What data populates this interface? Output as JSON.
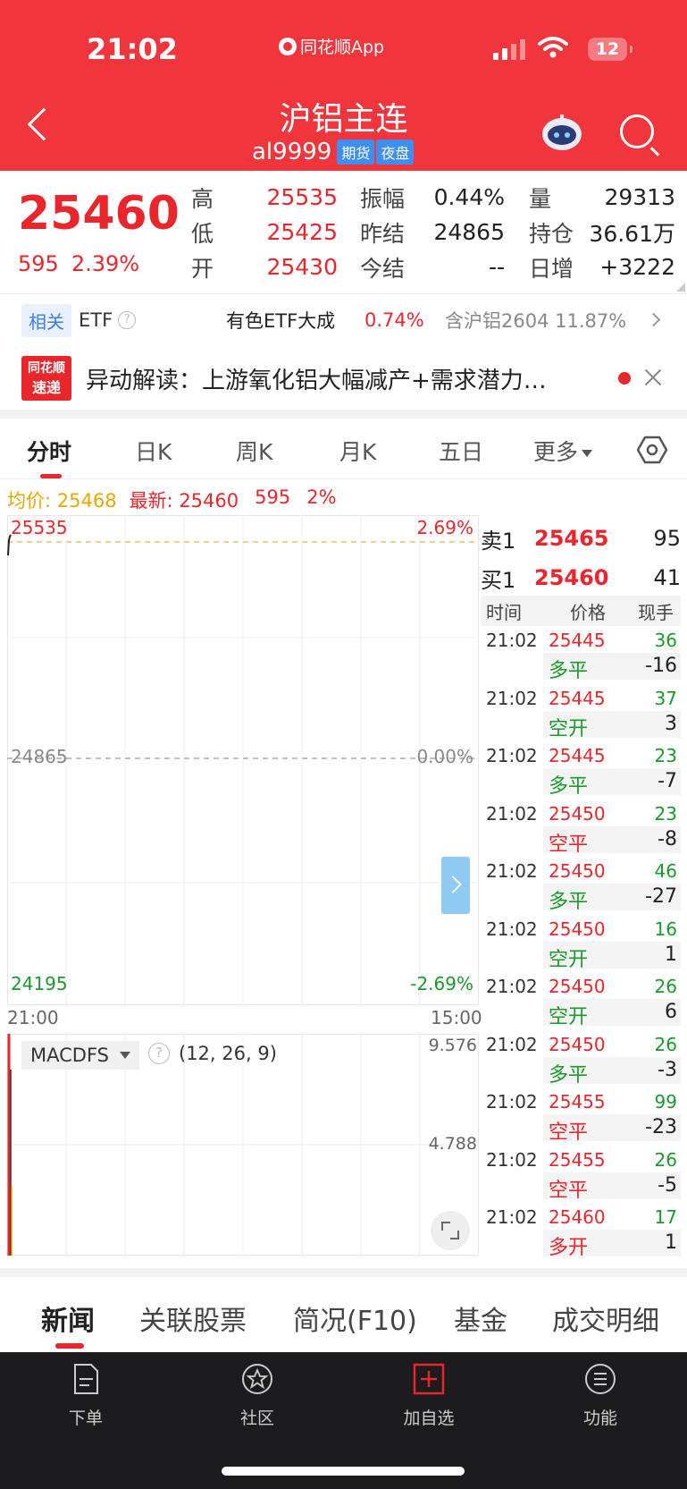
{
  "status": {
    "time": "21:02",
    "app": "同花顺App",
    "battery": "12"
  },
  "header": {
    "title": "沪铝主连",
    "code": "al9999",
    "tags": [
      "期货",
      "夜盘"
    ]
  },
  "quote": {
    "last": "25460",
    "change": "595",
    "change_pct": "2.39%",
    "fields": [
      {
        "label": "高",
        "value": "25535",
        "color": "red"
      },
      {
        "label": "低",
        "value": "25425",
        "color": "red"
      },
      {
        "label": "开",
        "value": "25430",
        "color": "red"
      },
      {
        "label": "振幅",
        "value": "0.44%",
        "color": "black"
      },
      {
        "label": "昨结",
        "value": "24865",
        "color": "black"
      },
      {
        "label": "今结",
        "value": "--",
        "color": "black"
      },
      {
        "label": "量",
        "value": "29313",
        "color": "black"
      },
      {
        "label": "持仓",
        "value": "36.61万",
        "color": "black"
      },
      {
        "label": "日增",
        "value": "+3222",
        "color": "black"
      }
    ]
  },
  "etf": {
    "badge": "相关",
    "label": "ETF",
    "help": "?",
    "name": "有色ETF大成",
    "pct": "0.74%",
    "hold": "含沪铝2604 11.87%"
  },
  "news": {
    "logo_line1": "同花顺",
    "logo_line2": "速递",
    "text": "异动解读：上游氧化铝大幅减产+需求潜力…"
  },
  "chart_tabs": [
    "分时",
    "日K",
    "周K",
    "月K",
    "五日",
    "更多"
  ],
  "price_info": {
    "avg_label": "均价: 25468",
    "latest_label": "最新: 25460",
    "chg": "595",
    "pct": "2%"
  },
  "chart": {
    "y_top": "25535",
    "y_top_pct": "2.69%",
    "y_mid": "24865",
    "y_mid_pct": "0.00%",
    "y_bot": "24195",
    "y_bot_pct": "-2.69%",
    "x_start": "21:00",
    "x_end": "15:00"
  },
  "macd": {
    "name": "MACDFS",
    "params": "(12, 26, 9)",
    "v1": "9.576",
    "v2": "4.788"
  },
  "order_book": {
    "ask": {
      "label": "卖1",
      "price": "25465",
      "qty": "95"
    },
    "bid": {
      "label": "买1",
      "price": "25460",
      "qty": "41"
    }
  },
  "tick_headers": [
    "时间",
    "价格",
    "现手"
  ],
  "ticks": [
    {
      "time": "21:02",
      "price": "25445",
      "vol": "36",
      "kind": "多平",
      "kind_color": "green",
      "net": "-16"
    },
    {
      "time": "21:02",
      "price": "25445",
      "vol": "37",
      "kind": "空开",
      "kind_color": "green",
      "net": "3"
    },
    {
      "time": "21:02",
      "price": "25445",
      "vol": "23",
      "kind": "多平",
      "kind_color": "green",
      "net": "-7"
    },
    {
      "time": "21:02",
      "price": "25450",
      "vol": "23",
      "kind": "空平",
      "kind_color": "red",
      "net": "-8"
    },
    {
      "time": "21:02",
      "price": "25450",
      "vol": "46",
      "kind": "多平",
      "kind_color": "green",
      "net": "-27"
    },
    {
      "time": "21:02",
      "price": "25450",
      "vol": "16",
      "kind": "空开",
      "kind_color": "green",
      "net": "1"
    },
    {
      "time": "21:02",
      "price": "25450",
      "vol": "26",
      "kind": "空开",
      "kind_color": "green",
      "net": "6"
    },
    {
      "time": "21:02",
      "price": "25450",
      "vol": "26",
      "kind": "多平",
      "kind_color": "green",
      "net": "-3"
    },
    {
      "time": "21:02",
      "price": "25455",
      "vol": "99",
      "kind": "空平",
      "kind_color": "red",
      "net": "-23"
    },
    {
      "time": "21:02",
      "price": "25455",
      "vol": "26",
      "kind": "空平",
      "kind_color": "red",
      "net": "-5"
    },
    {
      "time": "21:02",
      "price": "25460",
      "vol": "17",
      "kind": "多开",
      "kind_color": "red",
      "net": "1"
    }
  ],
  "bottom_tabs": [
    "新闻",
    "关联股票",
    "简况(F10)",
    "基金",
    "成交明细"
  ],
  "nav": [
    "下单",
    "社区",
    "加自选",
    "功能"
  ]
}
